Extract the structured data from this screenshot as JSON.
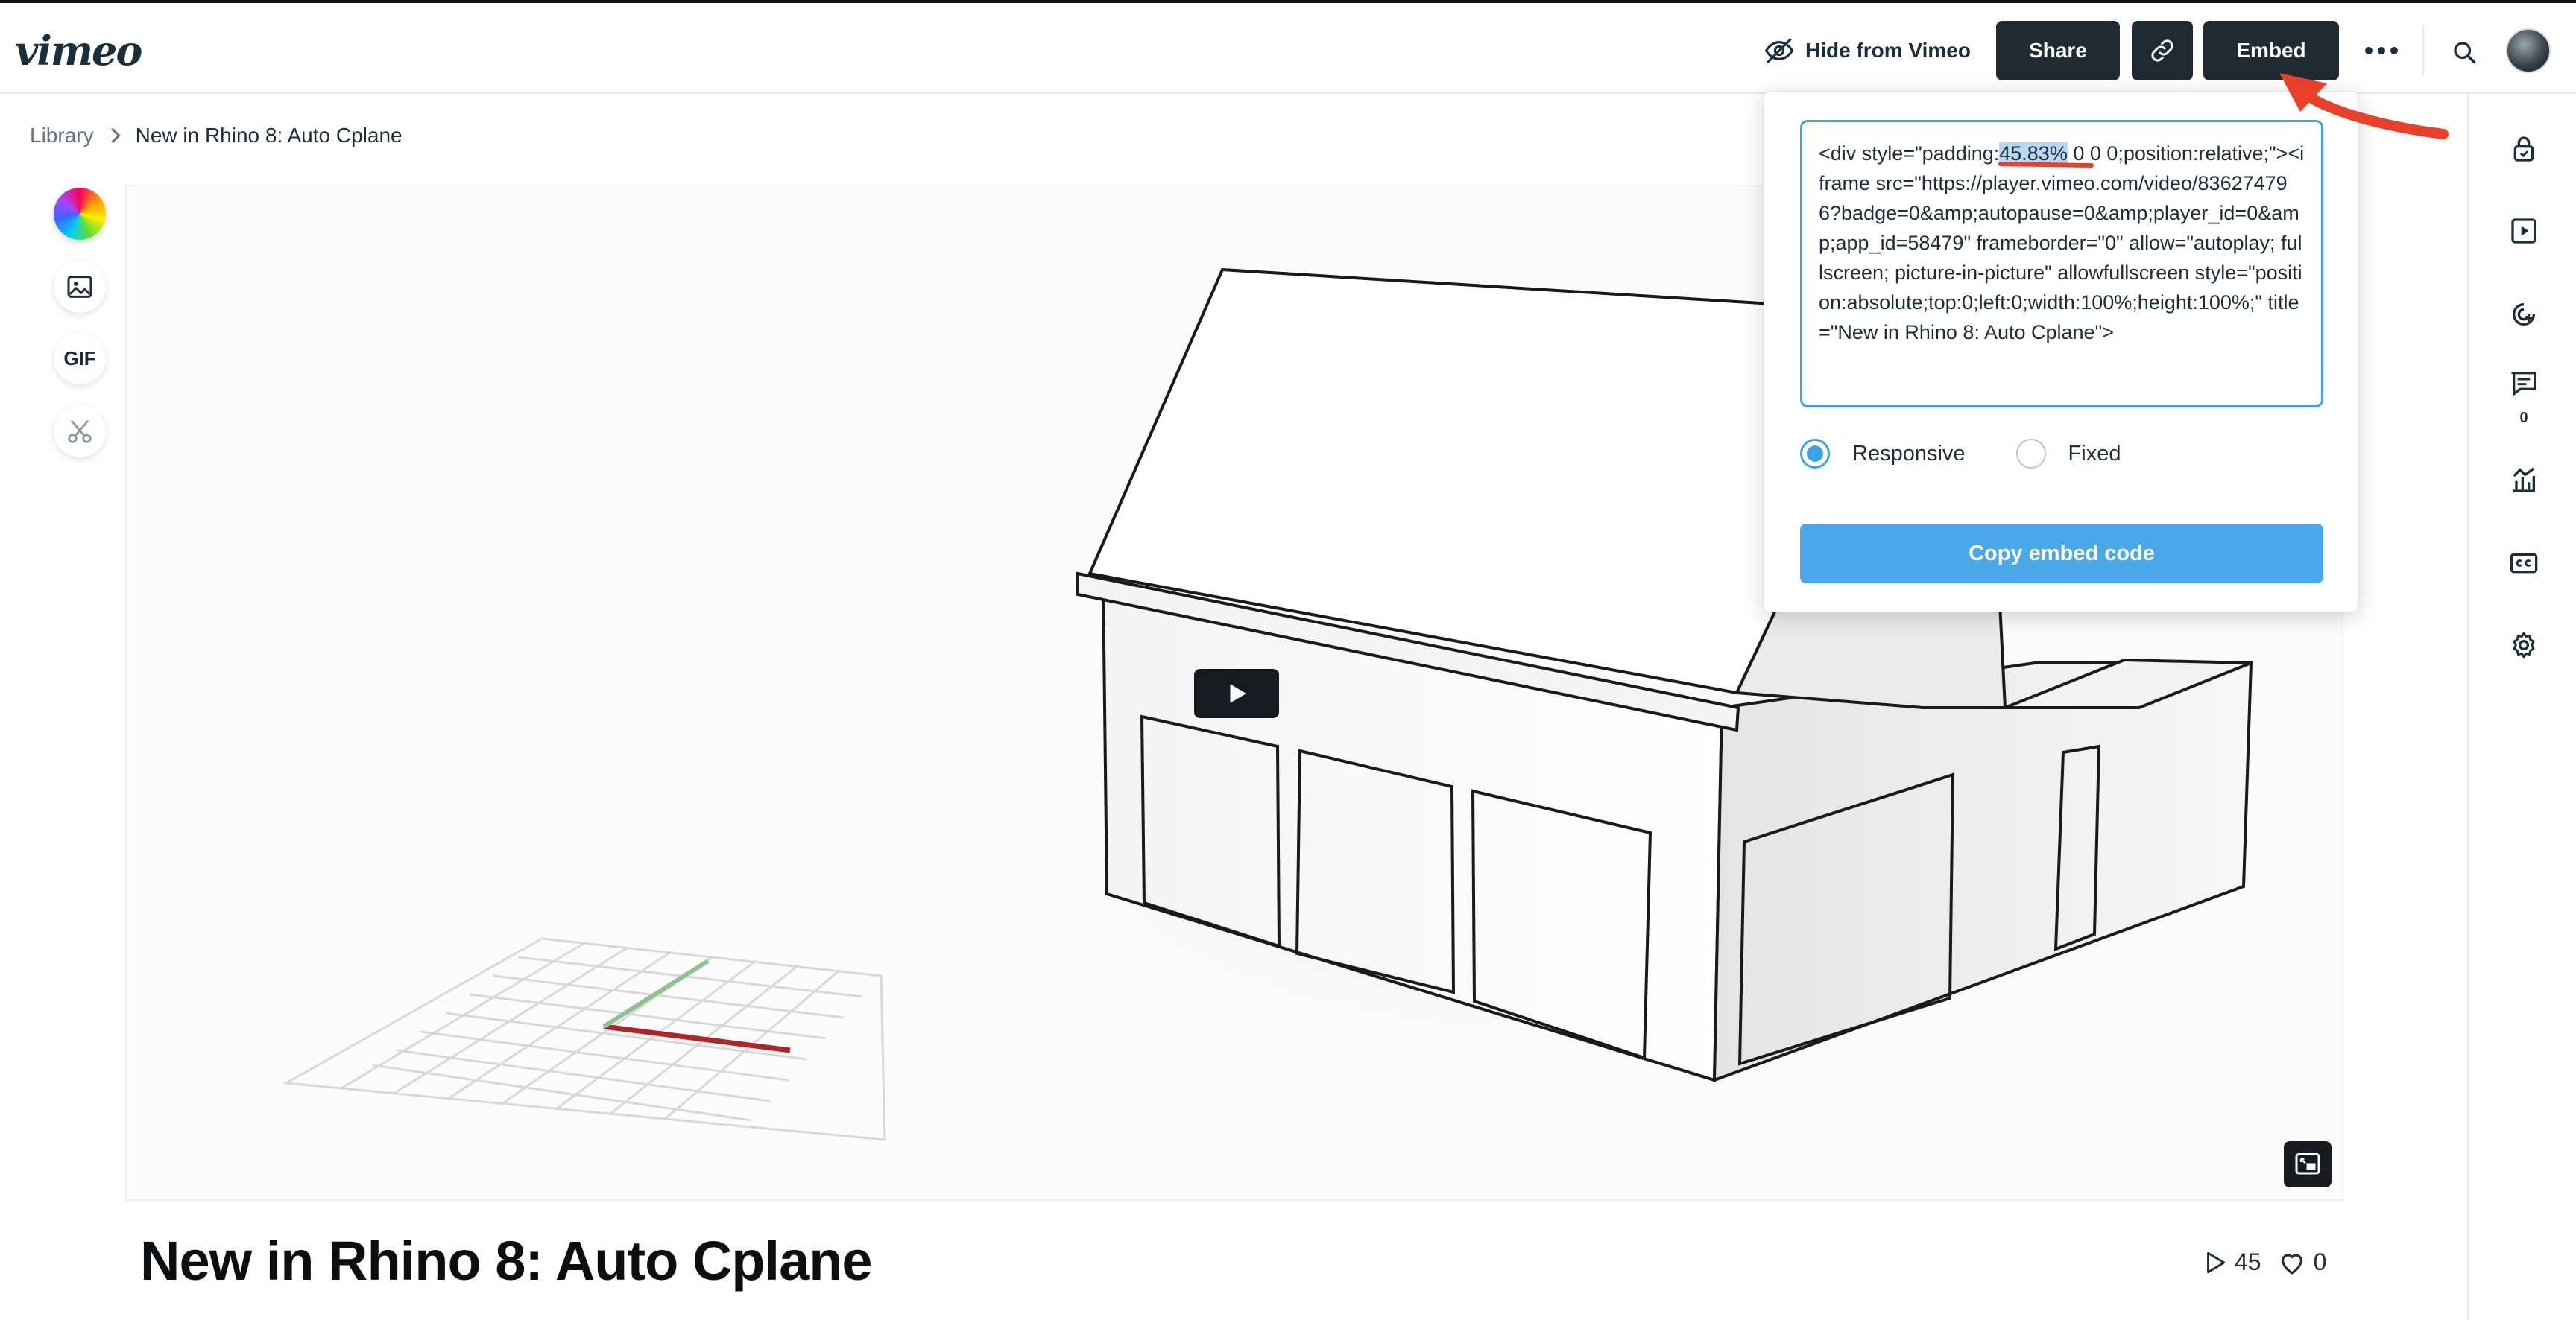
{
  "header": {
    "logo_text": "vimeo",
    "hide_label": "Hide from Vimeo",
    "share_label": "Share",
    "embed_label": "Embed"
  },
  "breadcrumb": {
    "root": "Library",
    "current": "New in Rhino 8: Auto Cplane"
  },
  "tools": {
    "gif_label": "GIF"
  },
  "video": {
    "title": "New in Rhino 8: Auto Cplane",
    "plays": "45",
    "likes": "0"
  },
  "sidebar": {
    "comments_count": "0"
  },
  "embed_popover": {
    "code_before": "<div style=\"padding:",
    "code_highlight": "45.83%",
    "code_after": " 0 0 0;position:relative;\"><iframe src=\"https://player.vimeo.com/video/836274796?badge=0&amp;autopause=0&amp;player_id=0&amp;app_id=58479\" frameborder=\"0\" allow=\"autoplay; fullscreen; picture-in-picture\" allowfullscreen style=\"position:absolute;top:0;left:0;width:100%;height:100%;\" title=\"New in Rhino 8: Auto Cplane\">",
    "option_responsive": "Responsive",
    "option_fixed": "Fixed",
    "selected_option": "Responsive",
    "copy_label": "Copy embed code"
  },
  "colors": {
    "accent": "#4aa8e8",
    "dark_button": "#1f2a33",
    "annotation_red": "#e8402a"
  },
  "icons": {
    "hide": "eye-slash-icon",
    "link": "link-icon",
    "more": "more-dots-icon",
    "search": "search-icon",
    "color_tool": "color-wheel-icon",
    "image_tool": "image-icon",
    "cut_tool": "scissors-icon",
    "play": "play-icon",
    "pip": "picture-in-picture-icon",
    "sidebar": [
      "lock-icon",
      "player-icon",
      "cursor-click-icon",
      "comment-icon",
      "analytics-icon",
      "captions-icon",
      "gear-icon"
    ]
  }
}
